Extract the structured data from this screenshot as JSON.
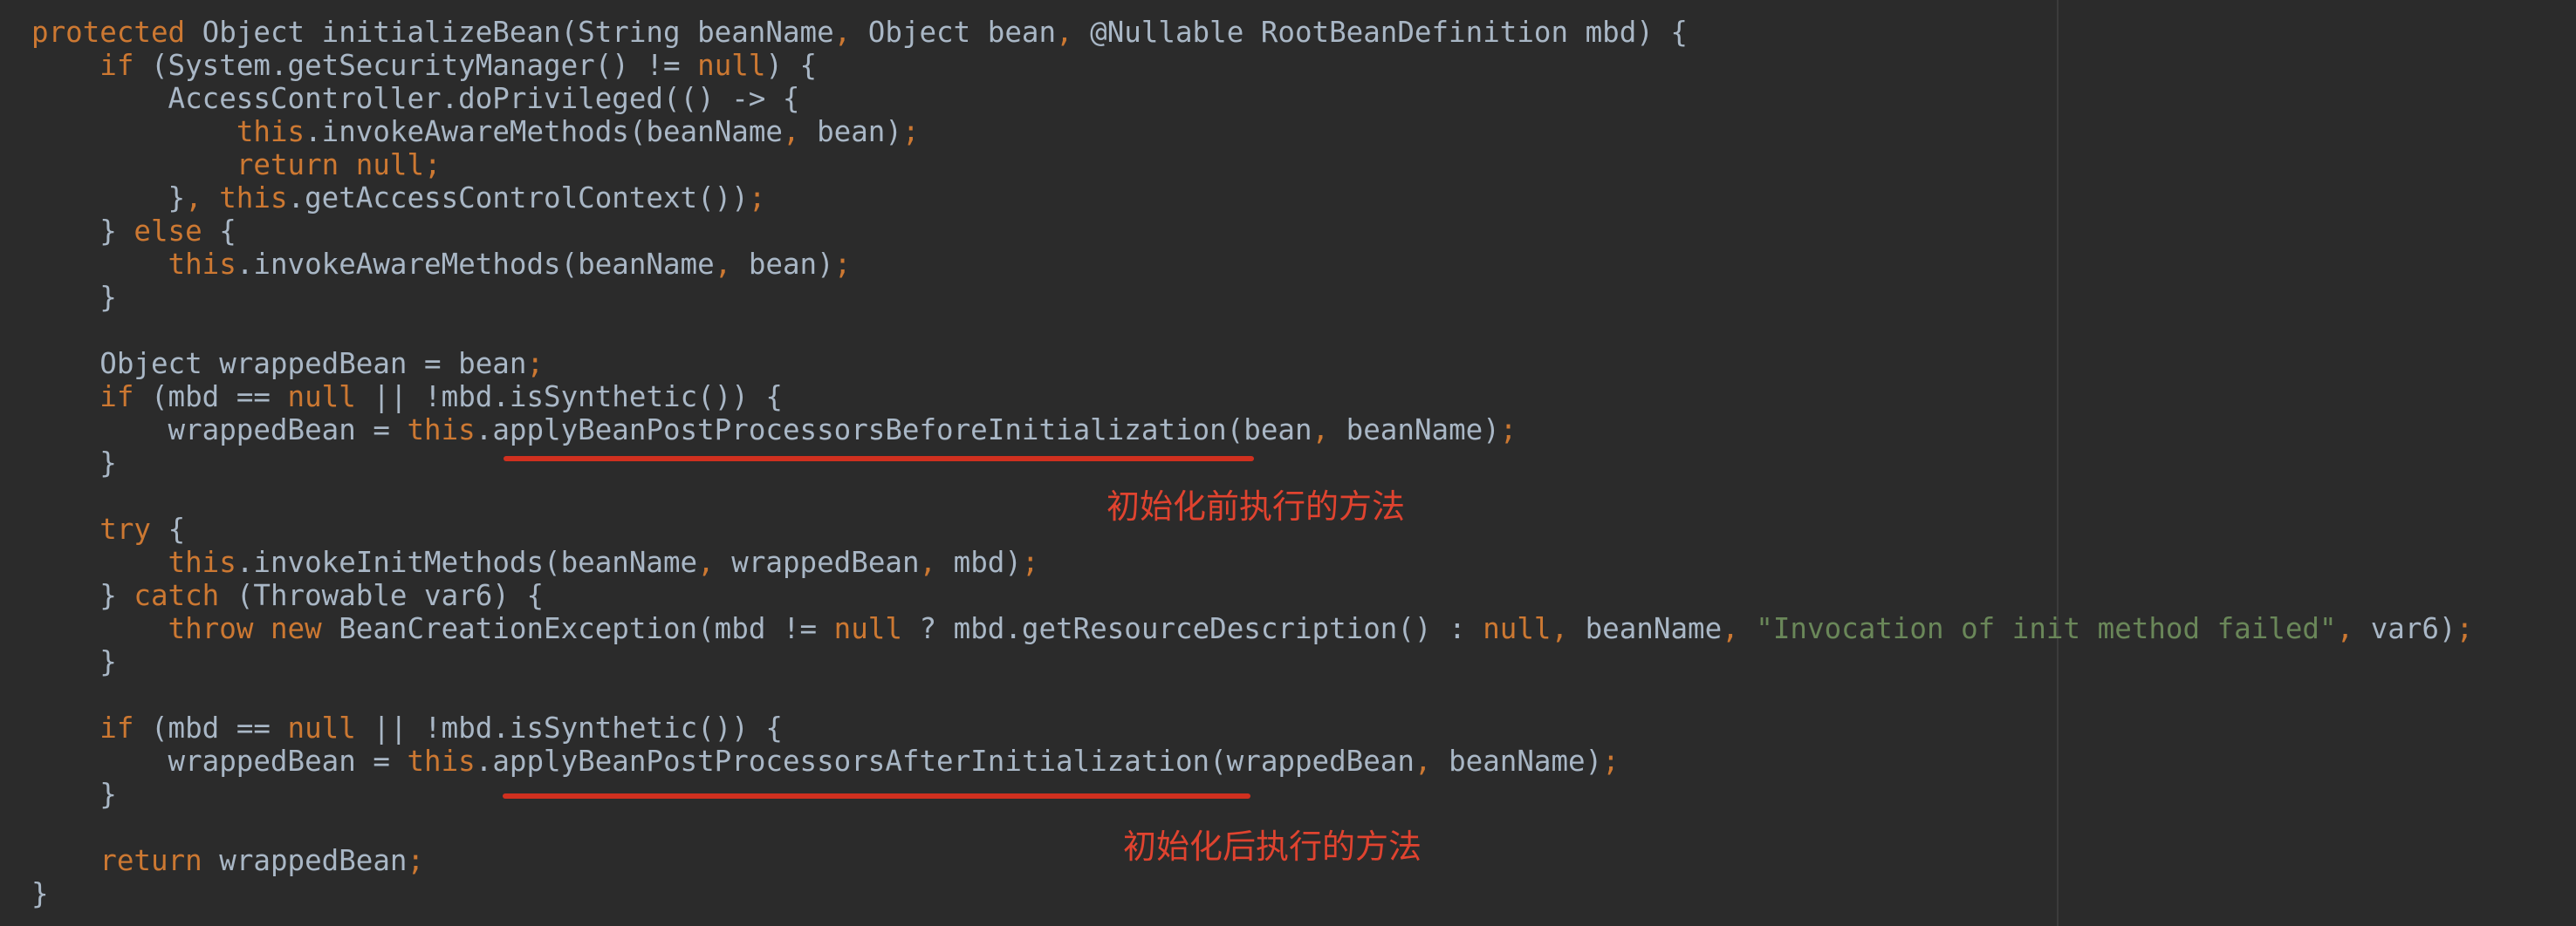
{
  "code_lines": [
    [
      [
        "kw",
        "protected "
      ],
      [
        "pl",
        "Object initializeBean(String beanName"
      ],
      [
        "kw",
        ", "
      ],
      [
        "pl",
        "Object bean"
      ],
      [
        "kw",
        ", "
      ],
      [
        "pl",
        "@Nullable RootBeanDefinition mbd) {"
      ]
    ],
    [
      [
        "pl",
        "    "
      ],
      [
        "kw",
        "if "
      ],
      [
        "pl",
        "(System.getSecurityManager() != "
      ],
      [
        "kw",
        "null"
      ],
      [
        "pl",
        ") {"
      ]
    ],
    [
      [
        "pl",
        "        AccessController.doPrivileged(() -> {"
      ]
    ],
    [
      [
        "pl",
        "            "
      ],
      [
        "kw",
        "this"
      ],
      [
        "pl",
        ".invokeAwareMethods(beanName"
      ],
      [
        "kw",
        ", "
      ],
      [
        "pl",
        "bean)"
      ],
      [
        "kw",
        ";"
      ]
    ],
    [
      [
        "pl",
        "            "
      ],
      [
        "kw",
        "return null;"
      ]
    ],
    [
      [
        "pl",
        "        }"
      ],
      [
        "kw",
        ", this"
      ],
      [
        "pl",
        ".getAccessControlContext())"
      ],
      [
        "kw",
        ";"
      ]
    ],
    [
      [
        "pl",
        "    } "
      ],
      [
        "kw",
        "else "
      ],
      [
        "pl",
        "{"
      ]
    ],
    [
      [
        "pl",
        "        "
      ],
      [
        "kw",
        "this"
      ],
      [
        "pl",
        ".invokeAwareMethods(beanName"
      ],
      [
        "kw",
        ", "
      ],
      [
        "pl",
        "bean)"
      ],
      [
        "kw",
        ";"
      ]
    ],
    [
      [
        "pl",
        "    }"
      ]
    ],
    [
      [
        "pl",
        ""
      ]
    ],
    [
      [
        "pl",
        "    Object wrappedBean = bean"
      ],
      [
        "kw",
        ";"
      ]
    ],
    [
      [
        "pl",
        "    "
      ],
      [
        "kw",
        "if "
      ],
      [
        "pl",
        "(mbd == "
      ],
      [
        "kw",
        "null "
      ],
      [
        "pl",
        "|| !mbd.isSynthetic()) {"
      ]
    ],
    [
      [
        "pl",
        "        wrappedBean = "
      ],
      [
        "kw",
        "this"
      ],
      [
        "pl",
        ".applyBeanPostProcessorsBeforeInitialization(bean"
      ],
      [
        "kw",
        ", "
      ],
      [
        "pl",
        "beanName)"
      ],
      [
        "kw",
        ";"
      ]
    ],
    [
      [
        "pl",
        "    }"
      ]
    ],
    [
      [
        "pl",
        ""
      ]
    ],
    [
      [
        "pl",
        "    "
      ],
      [
        "kw",
        "try "
      ],
      [
        "pl",
        "{"
      ]
    ],
    [
      [
        "pl",
        "        "
      ],
      [
        "kw",
        "this"
      ],
      [
        "pl",
        ".invokeInitMethods(beanName"
      ],
      [
        "kw",
        ", "
      ],
      [
        "pl",
        "wrappedBean"
      ],
      [
        "kw",
        ", "
      ],
      [
        "pl",
        "mbd)"
      ],
      [
        "kw",
        ";"
      ]
    ],
    [
      [
        "pl",
        "    } "
      ],
      [
        "kw",
        "catch "
      ],
      [
        "pl",
        "(Throwable var6) {"
      ]
    ],
    [
      [
        "pl",
        "        "
      ],
      [
        "kw",
        "throw new "
      ],
      [
        "pl",
        "BeanCreationException(mbd != "
      ],
      [
        "kw",
        "null "
      ],
      [
        "pl",
        "? mbd.getResourceDescription() : "
      ],
      [
        "kw",
        "null, "
      ],
      [
        "pl",
        "beanName"
      ],
      [
        "kw",
        ", "
      ],
      [
        "str",
        "\"Invocation of init method failed\""
      ],
      [
        "kw",
        ", "
      ],
      [
        "pl",
        "var6)"
      ],
      [
        "kw",
        ";"
      ]
    ],
    [
      [
        "pl",
        "    }"
      ]
    ],
    [
      [
        "pl",
        ""
      ]
    ],
    [
      [
        "pl",
        "    "
      ],
      [
        "kw",
        "if "
      ],
      [
        "pl",
        "(mbd == "
      ],
      [
        "kw",
        "null "
      ],
      [
        "pl",
        "|| !mbd.isSynthetic()) {"
      ]
    ],
    [
      [
        "pl",
        "        wrappedBean = "
      ],
      [
        "kw",
        "this"
      ],
      [
        "pl",
        ".applyBeanPostProcessorsAfterInitialization(wrappedBean"
      ],
      [
        "kw",
        ", "
      ],
      [
        "pl",
        "beanName)"
      ],
      [
        "kw",
        ";"
      ]
    ],
    [
      [
        "pl",
        "    }"
      ]
    ],
    [
      [
        "pl",
        ""
      ]
    ],
    [
      [
        "pl",
        "    "
      ],
      [
        "kw",
        "return "
      ],
      [
        "pl",
        "wrappedBean"
      ],
      [
        "kw",
        ";"
      ]
    ],
    [
      [
        "pl",
        "}"
      ]
    ]
  ],
  "annotations": {
    "before_init": "初始化前执行的方法",
    "after_init": "初始化后执行的方法"
  },
  "colors": {
    "background": "#2b2b2b",
    "keyword": "#cc7832",
    "plain": "#a9b7c6",
    "string": "#6a8759",
    "annotation": "#e0432f"
  }
}
